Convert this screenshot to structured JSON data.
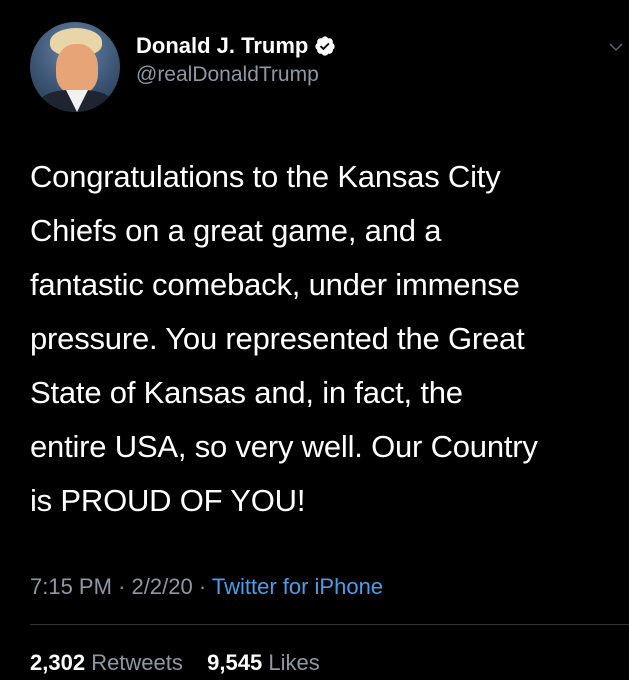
{
  "user": {
    "display_name": "Donald J. Trump",
    "handle": "@realDonaldTrump",
    "verified": true
  },
  "tweet": {
    "text": "Congratulations to the Kansas City\nChiefs on a great game, and a\nfantastic comeback, under immense\npressure. You represented the Great\nState of Kansas and, in fact, the\nentire USA, so very well. Our Country\nis PROUD OF YOU!",
    "time": "7:15 PM",
    "date": "2/2/20",
    "separator": "·",
    "source": "Twitter for iPhone"
  },
  "stats": {
    "retweets_count": "2,302",
    "retweets_label": "Retweets",
    "likes_count": "9,545",
    "likes_label": "Likes"
  },
  "colors": {
    "background": "#000000",
    "text_primary": "#ffffff",
    "text_secondary": "#8b98a5",
    "link": "#4a9ee8",
    "verified_badge": "#ffffff"
  },
  "icons": {
    "verified": "verified-badge-icon",
    "menu": "chevron-down-icon"
  }
}
